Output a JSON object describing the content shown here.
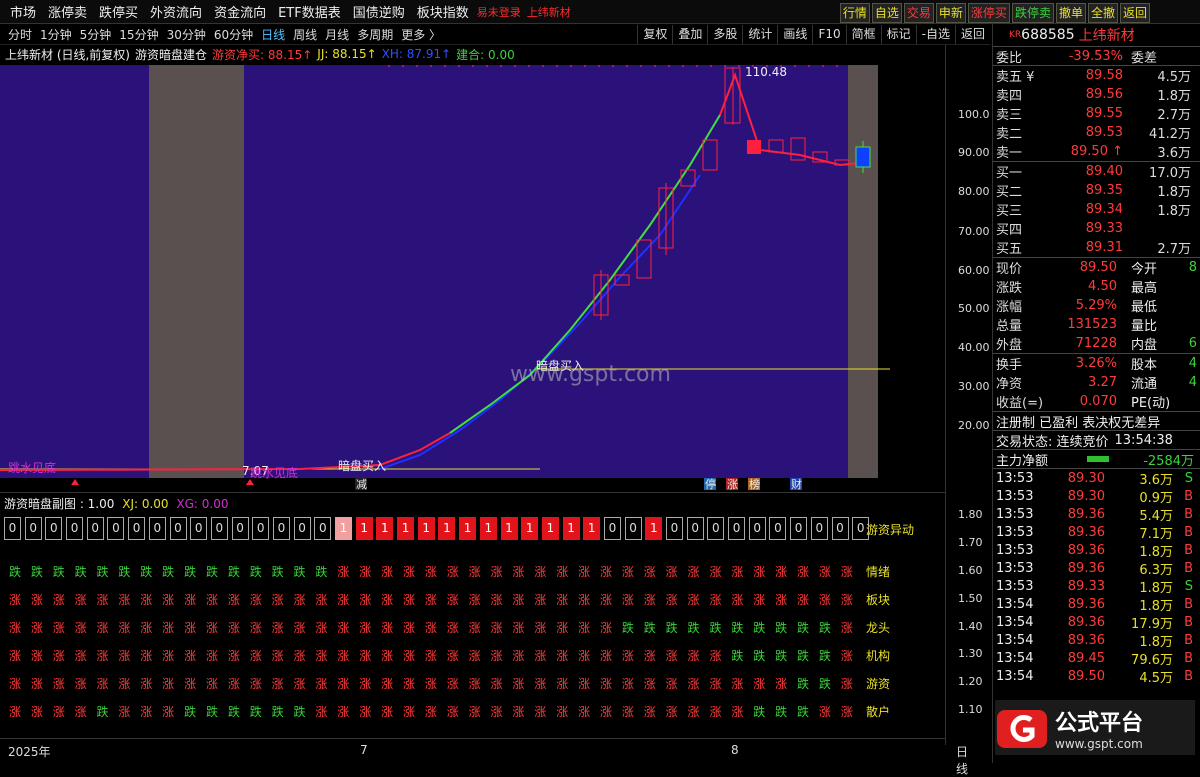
{
  "menu": [
    "市场",
    "涨停卖",
    "跌停买",
    "外资流向",
    "资金流向",
    "ETF数据表",
    "国债逆购",
    "板块指数"
  ],
  "menu_red": [
    "易未登录",
    "上纬新材"
  ],
  "quick": [
    "行情",
    "自选",
    "交易",
    "申新",
    "涨停买",
    "跌停卖",
    "撤单",
    "全撤",
    "返回"
  ],
  "periods": [
    "分时",
    "1分钟",
    "5分钟",
    "15分钟",
    "30分钟",
    "60分钟",
    "日线",
    "周线",
    "月线",
    "多周期",
    "更多 〉"
  ],
  "tools": [
    "复权",
    "叠加",
    "多股",
    "统计",
    "画线",
    "F10",
    "简框",
    "标记",
    "-自选",
    "返回"
  ],
  "info": {
    "title": "上纬新材 (日线,前复权)",
    "indicator": "游资暗盘建仓",
    "v1": "游资净买: 88.15↑",
    "v2": "JJ: 88.15↑",
    "v3": "XH: 87.91↑",
    "v4": "建合: 0.00"
  },
  "chart": {
    "high_label": "110.48",
    "low_label": "7.07",
    "buy_label_1": "暗盘买入",
    "buy_label_2": "暗盘买入",
    "left_label_1": "跳水见底",
    "left_label_2": "跳水见底",
    "watermark": "www.gspt.com",
    "markers": [
      "减",
      "停",
      "涨",
      "榜",
      "财"
    ]
  },
  "yaxis_main": [
    "100.0",
    "90.00",
    "80.00",
    "70.00",
    "60.00",
    "50.00",
    "40.00",
    "30.00",
    "20.00"
  ],
  "yaxis_sub": [
    "1.80",
    "1.70",
    "1.60",
    "1.50",
    "1.40",
    "1.30",
    "1.20",
    "1.10"
  ],
  "sub": {
    "title": "游资暗盘副图 : 1.00",
    "xj": "XJ: 0.00",
    "xg": "XG: 0.00",
    "cells": [
      "0",
      "0",
      "0",
      "0",
      "0",
      "0",
      "0",
      "0",
      "0",
      "0",
      "0",
      "0",
      "0",
      "0",
      "0",
      "0",
      "1",
      "1",
      "1",
      "1",
      "1",
      "1",
      "1",
      "1",
      "1",
      "1",
      "1",
      "1",
      "1",
      "0",
      "0",
      "1",
      "0",
      "0",
      "0",
      "0",
      "0",
      "0",
      "0",
      "0",
      "0",
      "0"
    ],
    "cells_label": "游资异动",
    "rows": [
      {
        "label": "情绪",
        "g": 15
      },
      {
        "label": "板块",
        "g": 0
      },
      {
        "label": "龙头",
        "g": -28
      },
      {
        "label": "机构",
        "g": -33
      },
      {
        "label": "游资",
        "g": -36
      },
      {
        "label": "散户",
        "g": -4
      }
    ]
  },
  "xaxis": [
    "2025年",
    "7",
    "8"
  ],
  "xaxis_right": "日线",
  "right": {
    "badge": "KR",
    "code": "688585",
    "name": "上纬新材",
    "weibi_label": "委比",
    "weibi": "-39.53%",
    "weicha_label": "委差",
    "asks": [
      {
        "l": "卖五 ¥",
        "p": "89.58",
        "v": "4.5万"
      },
      {
        "l": "卖四",
        "p": "89.56",
        "v": "1.8万"
      },
      {
        "l": "卖三",
        "p": "89.55",
        "v": "2.7万"
      },
      {
        "l": "卖二",
        "p": "89.53",
        "v": "41.2万"
      },
      {
        "l": "卖一",
        "p": "89.50 ↑",
        "v": "3.6万"
      }
    ],
    "bids": [
      {
        "l": "买一",
        "p": "89.40",
        "v": "17.0万"
      },
      {
        "l": "买二",
        "p": "89.35",
        "v": "1.8万"
      },
      {
        "l": "买三",
        "p": "89.34",
        "v": "1.8万"
      },
      {
        "l": "买四",
        "p": "89.33",
        "v": ""
      },
      {
        "l": "买五",
        "p": "89.31",
        "v": "2.7万"
      }
    ],
    "stats": [
      {
        "l": "现价",
        "v": "89.50",
        "l2": "今开",
        "v2": "8"
      },
      {
        "l": "涨跌",
        "v": "4.50",
        "l2": "最高",
        "v2": ""
      },
      {
        "l": "涨幅",
        "v": "5.29%",
        "l2": "最低",
        "v2": ""
      },
      {
        "l": "总量",
        "v": "131523",
        "l2": "量比",
        "v2": ""
      },
      {
        "l": "外盘",
        "v": "71228",
        "l2": "内盘",
        "v2": "6"
      }
    ],
    "stats2": [
      {
        "l": "换手",
        "v": "3.26%",
        "l2": "股本",
        "v2": "4"
      },
      {
        "l": "净资",
        "v": "3.27",
        "l2": "流通",
        "v2": "4"
      },
      {
        "l": "收益(=)",
        "v": "0.070",
        "l2": "PE(动)",
        "v2": ""
      }
    ],
    "reg": "注册制 已盈利 表决权无差异",
    "status_label": "交易状态: 连续竞价",
    "status_time": "13:54:38",
    "flow_label": "主力净额",
    "flow_value": "-2584万",
    "ticks": [
      {
        "t": "13:53",
        "p": "89.30",
        "v": "3.6万",
        "s": "S"
      },
      {
        "t": "13:53",
        "p": "89.30",
        "v": "0.9万",
        "s": "B"
      },
      {
        "t": "13:53",
        "p": "89.36",
        "v": "5.4万",
        "s": "B"
      },
      {
        "t": "13:53",
        "p": "89.36",
        "v": "7.1万",
        "s": "B"
      },
      {
        "t": "13:53",
        "p": "89.36",
        "v": "1.8万",
        "s": "B"
      },
      {
        "t": "13:53",
        "p": "89.36",
        "v": "6.3万",
        "s": "B"
      },
      {
        "t": "13:53",
        "p": "89.33",
        "v": "1.8万",
        "s": "S"
      },
      {
        "t": "13:54",
        "p": "89.36",
        "v": "1.8万",
        "s": "B"
      },
      {
        "t": "13:54",
        "p": "89.36",
        "v": "17.9万",
        "s": "B"
      },
      {
        "t": "13:54",
        "p": "89.36",
        "v": "1.8万",
        "s": "B"
      },
      {
        "t": "13:54",
        "p": "89.45",
        "v": "79.6万",
        "s": "B"
      },
      {
        "t": "13:54",
        "p": "89.50",
        "v": "4.5万",
        "s": "B"
      }
    ],
    "logo_text": "公式平台",
    "logo_url": "www.gspt.com"
  }
}
